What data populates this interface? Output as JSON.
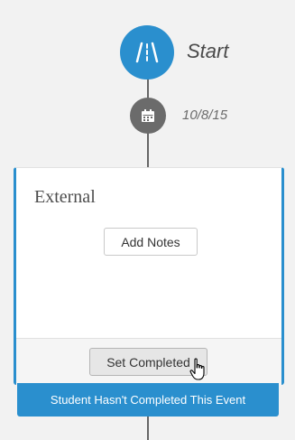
{
  "timeline": {
    "start_label": "Start",
    "start_icon": "road-icon",
    "date_label": "10/8/15",
    "date_icon": "calendar-icon"
  },
  "card": {
    "title": "External",
    "add_notes_label": "Add Notes",
    "set_completed_label": "Set Completed"
  },
  "status": {
    "text": "Student Hasn't Completed This Event"
  },
  "colors": {
    "accent": "#2a8fce",
    "node_gray": "#6b6b6b",
    "background": "#f2f2f2"
  }
}
